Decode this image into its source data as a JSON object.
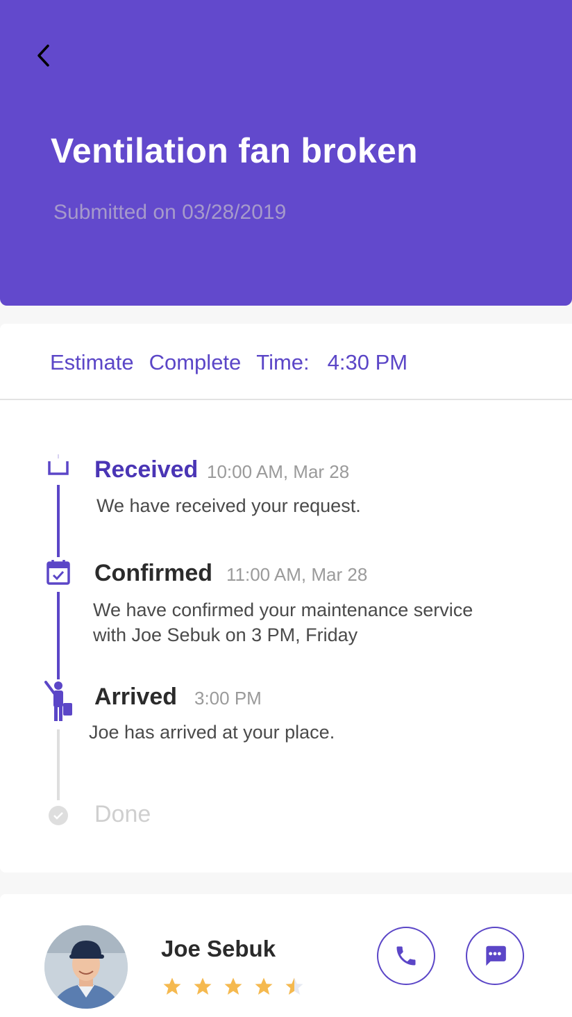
{
  "header": {
    "title": "Ventilation fan broken",
    "subtitle": "Submitted on 03/28/2019",
    "back_icon": "chevron-left-icon",
    "color": "#6249cc"
  },
  "estimate": {
    "words": [
      "Estimate",
      "Complete",
      "Time:"
    ],
    "value": "4:30 PM"
  },
  "timeline": [
    {
      "label": "Received",
      "time": "10:00 AM, Mar 28",
      "description": "We have received your request.",
      "icon": "inbox-icon",
      "status": "completed"
    },
    {
      "label": "Confirmed",
      "time": "11:00 AM, Mar 28",
      "description_lines": [
        "We have confirmed your maintenance service",
        "with Joe Sebuk on 3 PM, Friday"
      ],
      "icon": "calendar-check-icon",
      "status": "completed"
    },
    {
      "label": "Arrived",
      "time": "3:00 PM",
      "description": "Joe has arrived at your place.",
      "icon": "worker-arrived-icon",
      "status": "current"
    },
    {
      "label": "Done",
      "icon": "check-circle-icon",
      "status": "pending"
    }
  ],
  "technician": {
    "name": "Joe Sebuk",
    "rating": 4.5,
    "max_rating": 5,
    "call_icon": "phone-icon",
    "chat_icon": "chat-icon"
  },
  "colors": {
    "accent": "#5b46c7",
    "star": "#f5b94f",
    "muted": "#9a9a9a",
    "pending": "#dedede"
  }
}
